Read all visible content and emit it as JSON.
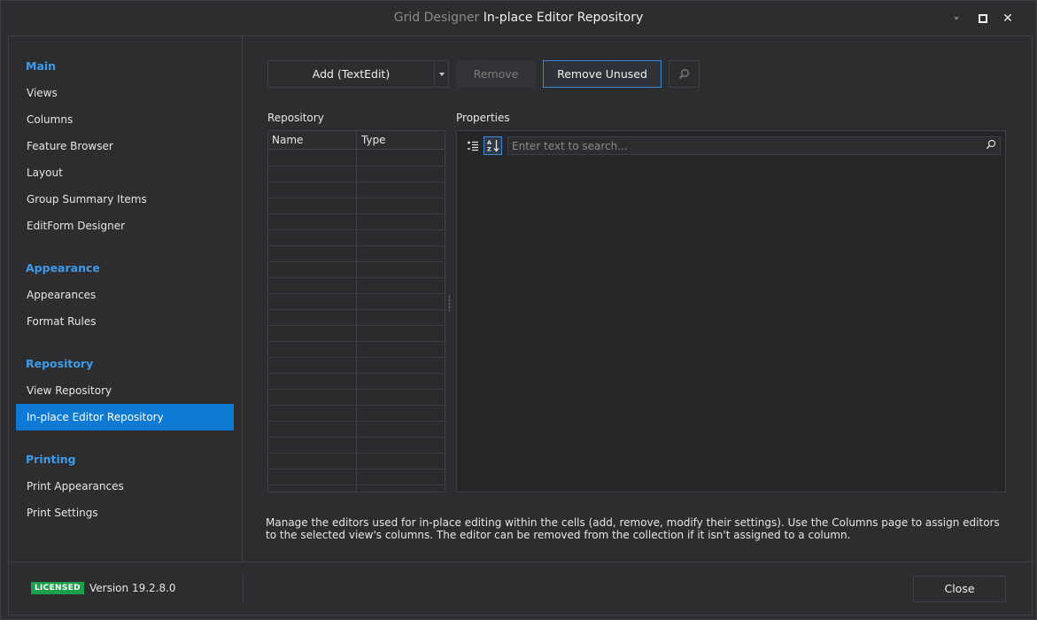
{
  "window": {
    "title_prefix": "Grid Designer",
    "title": "In-place Editor Repository"
  },
  "titlebar_icons": {
    "skin": "color-grid-icon",
    "maximize": "maximize-icon",
    "close_glyph": "✕"
  },
  "nav": {
    "groups": [
      {
        "label": "Main",
        "items": [
          "Views",
          "Columns",
          "Feature Browser",
          "Layout",
          "Group Summary Items",
          "EditForm Designer"
        ]
      },
      {
        "label": "Appearance",
        "items": [
          "Appearances",
          "Format Rules"
        ]
      },
      {
        "label": "Repository",
        "items": [
          "View Repository",
          "In-place Editor Repository"
        ]
      },
      {
        "label": "Printing",
        "items": [
          "Print Appearances",
          "Print Settings"
        ]
      }
    ],
    "selected": "In-place Editor Repository"
  },
  "toolbar": {
    "add_label": "Add (TextEdit)",
    "remove_label": "Remove",
    "remove_unused_label": "Remove Unused"
  },
  "repository": {
    "label": "Repository",
    "columns": [
      "Name",
      "Type"
    ],
    "rows": []
  },
  "properties": {
    "label": "Properties",
    "search_placeholder": "Enter text to search..."
  },
  "description": "Manage the editors used for in-place editing within the cells (add, remove, modify their settings). Use the Columns page to assign editors to the selected view's columns. The editor can be removed from the collection if it isn't assigned to a column.",
  "footer": {
    "license_badge": "LICENSED",
    "version": "Version 19.2.8.0",
    "close_label": "Close"
  },
  "colors": {
    "accent": "#0e7ad4",
    "group_header": "#3d9be9",
    "license_green": "#1aa04a",
    "background": "#2d2d30"
  }
}
